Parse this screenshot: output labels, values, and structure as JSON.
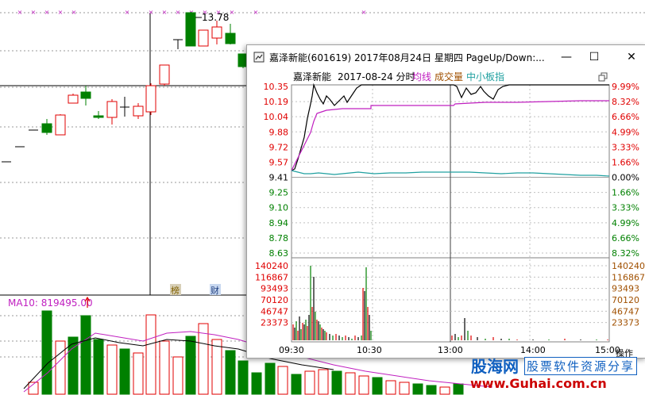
{
  "background_chart": {
    "peak_label": "13.78",
    "ma_label": "MA10: 819495.00",
    "badge1": "榜",
    "badge2": "财",
    "colors": {
      "up": "#e00000",
      "down": "#008000",
      "ma": "#c020c0",
      "ma2": "#000000",
      "marker": "#c020c0"
    }
  },
  "popup": {
    "window_title": "嘉泽新能(601619) 2017年08月24日 星期四 PageUp/Down:...",
    "header": {
      "name": "嘉泽新能",
      "date_time": "2017-08-24 分时",
      "legend_avg": "均线",
      "legend_volume": "成交量",
      "legend_index": "中小板指"
    },
    "price_ticks": [
      "10.35",
      "10.19",
      "10.04",
      "9.88",
      "9.72",
      "9.57",
      "9.41",
      "9.25",
      "9.10",
      "8.94",
      "8.78",
      "8.63"
    ],
    "pct_ticks": [
      "9.99%",
      "8.32%",
      "6.66%",
      "4.99%",
      "3.33%",
      "1.66%",
      "0.00%",
      "1.66%",
      "3.33%",
      "4.99%",
      "6.66%",
      "8.32%"
    ],
    "volume_ticks": [
      "140240",
      "116867",
      "93493",
      "70120",
      "46747",
      "23373"
    ],
    "time_ticks": [
      "09:30",
      "10:30",
      "13:00",
      "14:00",
      "15:00"
    ],
    "corner_text": "操作",
    "colors": {
      "price_line": "#000000",
      "avg_line": "#c020c0",
      "index_line": "#20a0a0",
      "up": "#e00000",
      "down": "#008000",
      "flat": "#000000"
    }
  },
  "watermark": {
    "brand": "股海网",
    "slogan": "股票软件资源分享",
    "url": "www.Guhai.com.cn"
  }
}
